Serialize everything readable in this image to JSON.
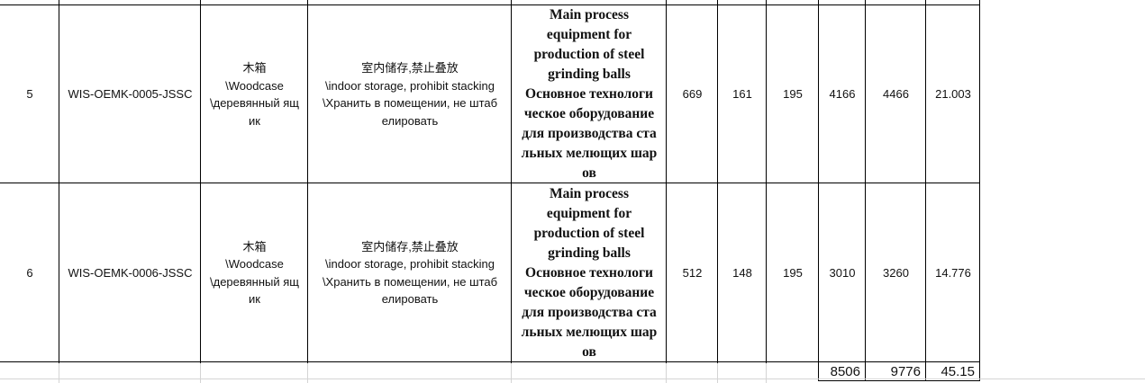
{
  "rows": [
    {
      "no": "5",
      "code": "WIS-OEMK-0005-JSSC",
      "package": "木箱\n\\Woodcase\n\\деревянный ящ\nик",
      "storage": "室内储存,禁止叠放\n\\indoor storage, prohibit stacking\n\\Хранить в помещении, не штаб\nелировать",
      "description": "Main process\nequipment for\nproduction of steel\ngrinding balls\nОсновное технологи\nческое оборудование\nдля производства ста\nльных мелющих шар\nов",
      "length": "669",
      "width": "161",
      "height": "195",
      "net": "4166",
      "gross": "4466",
      "volume": "21.003"
    },
    {
      "no": "6",
      "code": "WIS-OEMK-0006-JSSC",
      "package": "木箱\n\\Woodcase\n\\деревянный ящ\nик",
      "storage": "室内储存,禁止叠放\n\\indoor storage, prohibit stacking\n\\Хранить в помещении, не штаб\nелировать",
      "description": "Main process\nequipment for\nproduction of steel\ngrinding balls\nОсновное технологи\nческое оборудование\nдля производства ста\nльных мелющих шар\nов",
      "length": "512",
      "width": "148",
      "height": "195",
      "net": "3010",
      "gross": "3260",
      "volume": "14.776"
    }
  ],
  "totals": {
    "net": "8506",
    "gross": "9776",
    "volume": "45.15"
  }
}
